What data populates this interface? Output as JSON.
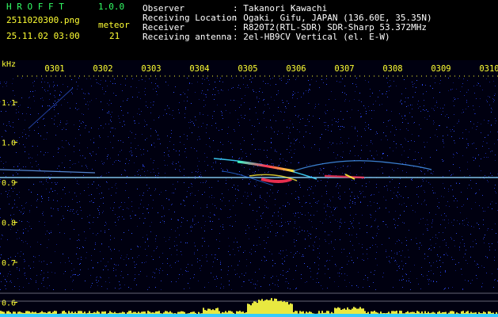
{
  "header": {
    "app_name": "H R O F F T",
    "version": "1.0.0",
    "filename": "2511020300.png",
    "datetime": "25.11.02 03:00",
    "meteor_label": "meteor",
    "meteor_count": "21"
  },
  "info": {
    "observer_label": "Observer",
    "observer_value": ": Takanori Kawachi",
    "location_label": "Receiving Location",
    "location_value": ": Ogaki, Gifu, JAPAN (136.60E, 35.35N)",
    "receiver_label": "Receiver",
    "receiver_value": ": R820T2(RTL-SDR) SDR-Sharp 53.372MHz",
    "antenna_label": "Receiving antenna",
    "antenna_value": ": 2el-HB9CV Vertical (el. E-W)"
  },
  "spectrogram": {
    "y_unit": "kHz",
    "y_ticks": [
      "1.1",
      "1.0",
      "0.9",
      "0.8",
      "0.7",
      "0.6"
    ],
    "time_ticks": [
      "0301",
      "0302",
      "0303",
      "0304",
      "0305",
      "0306",
      "0307",
      "0308",
      "0309",
      "0310"
    ],
    "carrier_khz": 0.913,
    "colors": {
      "background": "#000010",
      "noise": "#1a2aa8",
      "carrier": "#8fd8ff",
      "echo_hot": "#ff3355",
      "axis_tick": "#ffff33",
      "time_label": "#ffff33"
    }
  }
}
